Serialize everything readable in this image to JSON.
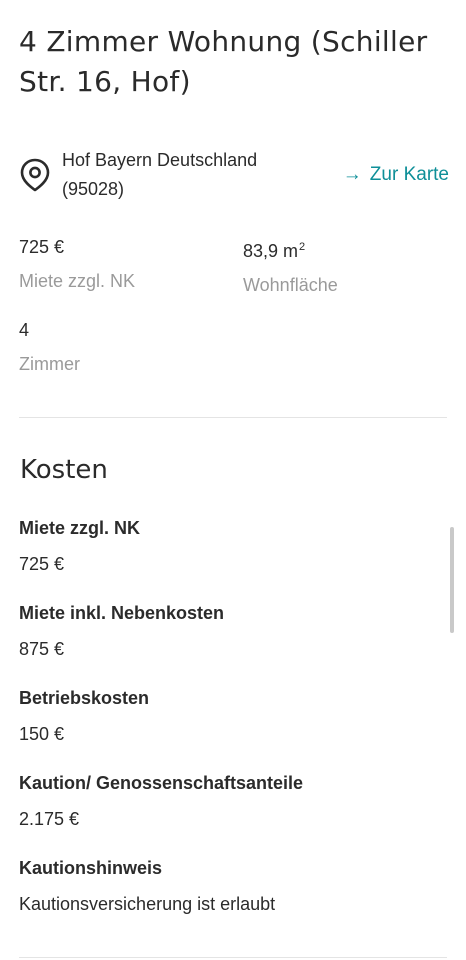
{
  "listing": {
    "title": "4 Zimmer Wohnung (Schiller Str. 16, Hof)",
    "address_line1": "Hof Bayern Deutschland",
    "address_line2": "(95028)",
    "map_link_label": "Zur Karte",
    "map_link_arrow": "→"
  },
  "facts": {
    "rent_value": "725 €",
    "rent_label": "Miete zzgl. NK",
    "area_value": "83,9 m",
    "area_unit_sup": "2",
    "area_label": "Wohnfläche",
    "rooms_value": "4",
    "rooms_label": "Zimmer"
  },
  "costs": {
    "section_title": "Kosten",
    "items": [
      {
        "label": "Miete zzgl. NK",
        "value": "725 €"
      },
      {
        "label": "Miete inkl. Nebenkosten",
        "value": "875 €"
      },
      {
        "label": "Betriebskosten",
        "value": "150 €"
      },
      {
        "label": "Kaution/ Genossenschaftsanteile",
        "value": "2.175 €"
      },
      {
        "label": "Kautionshinweis",
        "value": "Kautionsversicherung ist erlaubt"
      }
    ]
  },
  "colors": {
    "accent": "#0e8f98",
    "muted_text": "#9a9a9a",
    "text": "#2b2b2b",
    "divider": "#e4e4e4"
  },
  "icons": {
    "location": "map-pin-icon",
    "arrow": "arrow-right-icon"
  }
}
